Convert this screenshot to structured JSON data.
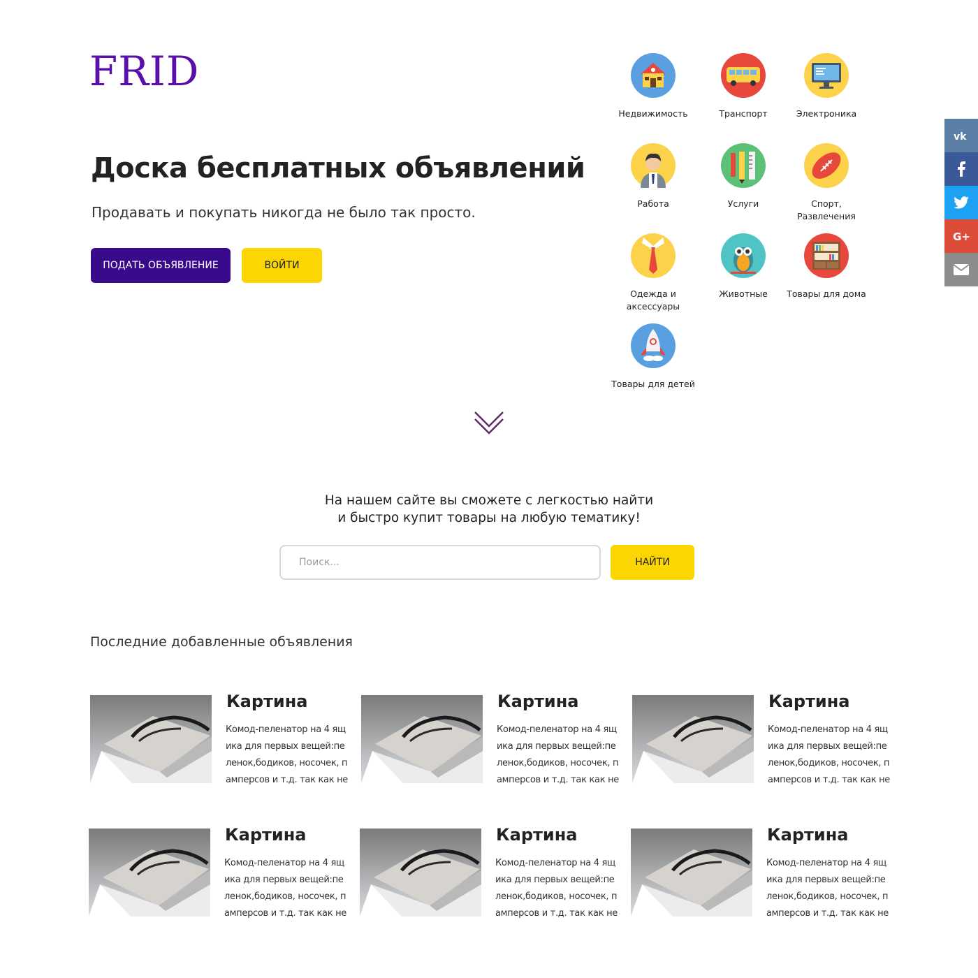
{
  "brand": {
    "logo": "FRID"
  },
  "hero": {
    "title": "Доска бесплатных объявлений",
    "subtitle": "Продавать и покупать никогда не было так просто.",
    "post_button": "ПОДАТЬ ОБЪЯВЛЕНИЕ",
    "login_button": "ВОЙТИ"
  },
  "categories": [
    {
      "label": "Недвижимость",
      "icon": "house-icon"
    },
    {
      "label": "Транспорт",
      "icon": "bus-icon"
    },
    {
      "label": "Электроника",
      "icon": "monitor-icon"
    },
    {
      "label": "Работа",
      "icon": "worker-icon"
    },
    {
      "label": "Услуги",
      "icon": "tools-icon"
    },
    {
      "label": "Спорт, Развлечения",
      "icon": "football-icon"
    },
    {
      "label": "Одежда и аксессуары",
      "icon": "shirt-tie-icon"
    },
    {
      "label": "Животные",
      "icon": "owl-icon"
    },
    {
      "label": "Товары для дома",
      "icon": "shelf-icon"
    },
    {
      "label": "Товары для детей",
      "icon": "rocket-icon"
    }
  ],
  "search": {
    "line1": "На нашем сайте вы сможете с легкостью найти",
    "line2": "и быстро купит товары на любую тематику!",
    "placeholder": "Поиск...",
    "button": "НАЙТИ"
  },
  "latest": {
    "title": "Последние добавленные объявления",
    "items": [
      {
        "title": "Картина",
        "desc": "Комод-пеленатор на 4 ящика для первых вещей:пеленок,бодиков, носочек, памперсов и т.д. так как не очень…"
      },
      {
        "title": "Картина",
        "desc": "Комод-пеленатор на 4 ящика для первых вещей:пеленок,бодиков, носочек, памперсов и т.д. так как не очень…"
      },
      {
        "title": "Картина",
        "desc": "Комод-пеленатор на 4 ящика для первых вещей:пеленок,бодиков, носочек, памперсов и т.д. так как не очень…"
      },
      {
        "title": "Картина",
        "desc": "Комод-пеленатор на 4 ящика для первых вещей:пеленок,бодиков, носочек, памперсов и т.д. так как не очень…"
      },
      {
        "title": "Картина",
        "desc": "Комод-пеленатор на 4 ящика для первых вещей:пеленок,бодиков, носочек, памперсов и т.д. так как не очень…"
      },
      {
        "title": "Картина",
        "desc": "Комод-пеленатор на 4 ящика для первых вещей:пеленок,бодиков, носочек, памперсов и т.д. так как не очень…"
      }
    ]
  },
  "social": [
    {
      "name": "vk-icon",
      "glyph": "vk",
      "color": "#5b7fa6"
    },
    {
      "name": "facebook-icon",
      "glyph": "f",
      "color": "#3b5998"
    },
    {
      "name": "twitter-icon",
      "glyph": "t",
      "color": "#1da1f2"
    },
    {
      "name": "google-plus-icon",
      "glyph": "G+",
      "color": "#dd4b39"
    },
    {
      "name": "email-icon",
      "glyph": "✉",
      "color": "#8c8c8c"
    }
  ],
  "colors": {
    "brand": "#5a0fa8",
    "primary_button": "#3a0a8c",
    "accent": "#fbd603"
  }
}
